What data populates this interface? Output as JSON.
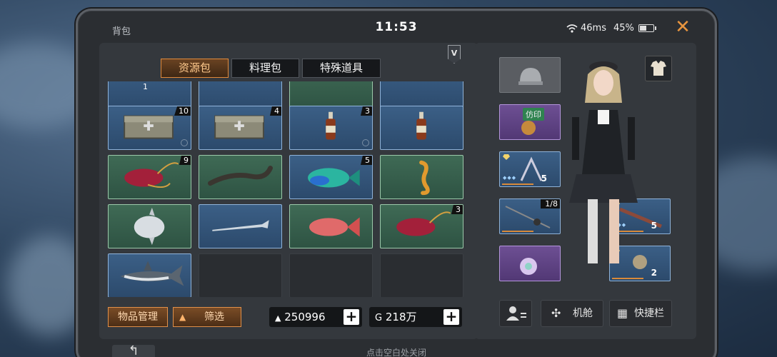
{
  "status": {
    "title": "背包",
    "clock": "11:53",
    "ping": "46ms",
    "battery": "45%"
  },
  "tabs": [
    {
      "label": "资源包",
      "active": true
    },
    {
      "label": "料理包",
      "active": false
    },
    {
      "label": "特殊道具",
      "active": false
    }
  ],
  "grid": {
    "partial_row": [
      {
        "count": "1"
      }
    ],
    "items": [
      {
        "name": "medical-crate",
        "color": "blue",
        "count": "10"
      },
      {
        "name": "medical-crate",
        "color": "blue",
        "count": "4"
      },
      {
        "name": "bottle",
        "color": "blue",
        "count": "3"
      },
      {
        "name": "bottle",
        "color": "blue",
        "count": ""
      },
      {
        "name": "red-meat",
        "color": "green",
        "count": "9"
      },
      {
        "name": "eel",
        "color": "green",
        "count": ""
      },
      {
        "name": "parrotfish",
        "color": "blue",
        "count": "5"
      },
      {
        "name": "seahorse",
        "color": "green",
        "count": ""
      },
      {
        "name": "sunfish",
        "color": "green",
        "count": ""
      },
      {
        "name": "needlefish",
        "color": "blue",
        "count": ""
      },
      {
        "name": "red-snapper",
        "color": "green",
        "count": ""
      },
      {
        "name": "red-meat",
        "color": "green",
        "count": "3"
      },
      {
        "name": "shark",
        "color": "blue",
        "count": ""
      },
      {
        "name": "empty",
        "color": "empty",
        "count": ""
      },
      {
        "name": "empty",
        "color": "empty",
        "count": ""
      },
      {
        "name": "empty",
        "color": "empty",
        "count": ""
      }
    ]
  },
  "bottom": {
    "manage_label": "物品管理",
    "filter_label": "筛选",
    "resource_amount": "250996",
    "gold_amount": "218万"
  },
  "equipment": {
    "seal_label": "仿印",
    "weapon1_level": "5",
    "rod_count": "1/8",
    "weapon2_level": "5",
    "ring_level": "2"
  },
  "right_buttons": {
    "cabin_label": "机舱",
    "shortcut_label": "快捷栏"
  },
  "footer": "点击空白处关闭"
}
